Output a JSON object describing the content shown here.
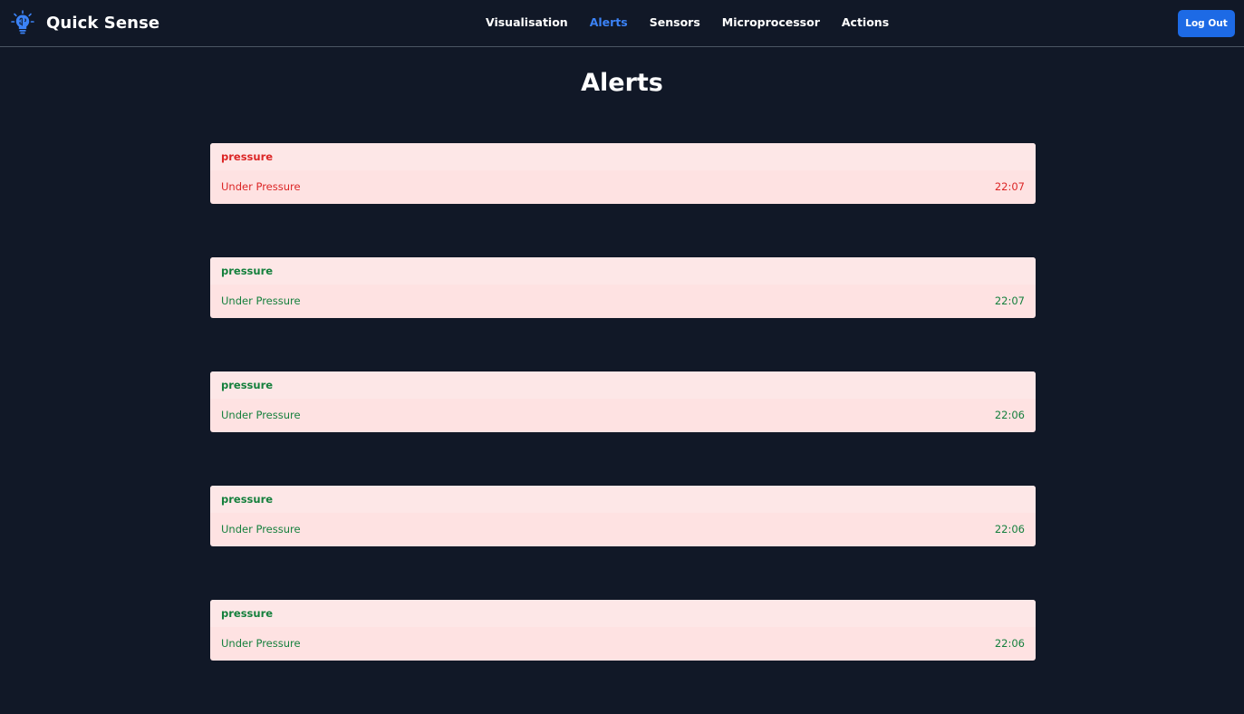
{
  "brand": {
    "name": "Quick Sense",
    "logo_icon": "brain-bulb-icon",
    "logo_color": "#3b82f6"
  },
  "nav": {
    "items": [
      {
        "label": "Visualisation",
        "active": false
      },
      {
        "label": "Alerts",
        "active": true
      },
      {
        "label": "Sensors",
        "active": false
      },
      {
        "label": "Microprocessor",
        "active": false
      },
      {
        "label": "Actions",
        "active": false
      }
    ],
    "logout_label": "Log Out"
  },
  "page": {
    "title": "Alerts"
  },
  "alerts": [
    {
      "type": "pressure",
      "message": "Under Pressure",
      "time": "22:07",
      "status_color": "red"
    },
    {
      "type": "pressure",
      "message": "Under Pressure",
      "time": "22:07",
      "status_color": "green"
    },
    {
      "type": "pressure",
      "message": "Under Pressure",
      "time": "22:06",
      "status_color": "green"
    },
    {
      "type": "pressure",
      "message": "Under Pressure",
      "time": "22:06",
      "status_color": "green"
    },
    {
      "type": "pressure",
      "message": "Under Pressure",
      "time": "22:06",
      "status_color": "green"
    }
  ],
  "colors": {
    "background": "#111827",
    "accent": "#3b82f6",
    "button": "#1d6ae5",
    "card": "#fee2e2",
    "red_text": "#dc2626",
    "green_text": "#15803d"
  }
}
